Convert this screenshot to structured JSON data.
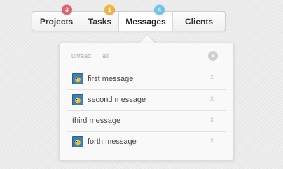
{
  "tabs": [
    {
      "label": "Projects",
      "badge": "3",
      "badge_color": "#e0606e"
    },
    {
      "label": "Tasks",
      "badge": "1",
      "badge_color": "#f0b23a"
    },
    {
      "label": "Messages",
      "badge": "4",
      "badge_color": "#6fc3e6",
      "active": true
    },
    {
      "label": "Clients"
    }
  ],
  "dropdown": {
    "filters": {
      "unread": "unread",
      "all": "all"
    },
    "close_all_icon": "x-circle-icon",
    "close_all_glyph": "×",
    "messages": [
      {
        "text": "first message",
        "avatar": "bird-avatar-icon",
        "dismiss": "x"
      },
      {
        "text": "second message",
        "avatar": "bird-avatar-icon",
        "dismiss": "x"
      },
      {
        "text": "third message",
        "dismiss": "x"
      },
      {
        "text": "forth message",
        "avatar": "bird-avatar-icon",
        "dismiss": "x"
      }
    ]
  },
  "colors": {
    "background": "#ebebeb",
    "panel": "#f9f9f9",
    "text": "#333333",
    "muted": "#a8a8a8"
  }
}
